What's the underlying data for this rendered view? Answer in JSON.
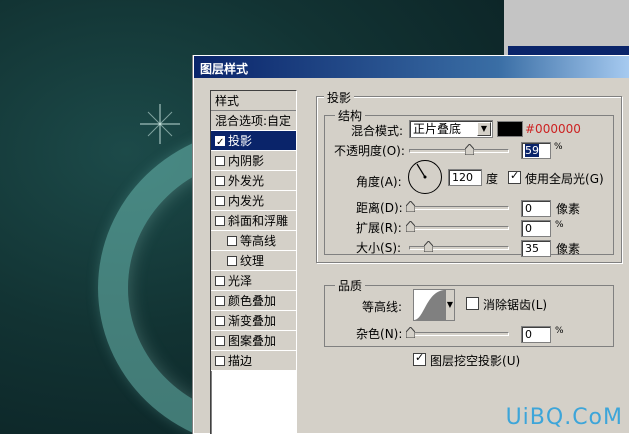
{
  "dialog": {
    "title": "图层样式"
  },
  "sidebar": {
    "header": "样式",
    "blend_options": "混合选项:自定",
    "items": [
      {
        "label": "投影",
        "checked": true,
        "active": true,
        "indent": false
      },
      {
        "label": "内阴影",
        "checked": false,
        "active": false,
        "indent": false
      },
      {
        "label": "外发光",
        "checked": false,
        "active": false,
        "indent": false
      },
      {
        "label": "内发光",
        "checked": false,
        "active": false,
        "indent": false
      },
      {
        "label": "斜面和浮雕",
        "checked": false,
        "active": false,
        "indent": false
      },
      {
        "label": "等高线",
        "checked": false,
        "active": false,
        "indent": true
      },
      {
        "label": "纹理",
        "checked": false,
        "active": false,
        "indent": true
      },
      {
        "label": "光泽",
        "checked": false,
        "active": false,
        "indent": false
      },
      {
        "label": "颜色叠加",
        "checked": false,
        "active": false,
        "indent": false
      },
      {
        "label": "渐变叠加",
        "checked": false,
        "active": false,
        "indent": false
      },
      {
        "label": "图案叠加",
        "checked": false,
        "active": false,
        "indent": false
      },
      {
        "label": "描边",
        "checked": false,
        "active": false,
        "indent": false
      }
    ]
  },
  "shadow": {
    "section_title": "投影",
    "structure_title": "结构",
    "blend_mode_label": "混合模式:",
    "blend_mode_value": "正片叠底",
    "color_hex": "#000000",
    "opacity_label": "不透明度",
    "opacity_key": "(O):",
    "opacity_value": "59",
    "opacity_fraction": 0.59,
    "percent": "%",
    "angle_label": "角度",
    "angle_key": "(A):",
    "angle_value": "120",
    "angle_unit": "度",
    "global_light_label": "使用全局光",
    "global_light_key": "(G)",
    "global_light_checked": true,
    "distance_label": "距离",
    "distance_key": "(D):",
    "distance_value": "0",
    "spread_label": "扩展",
    "spread_key": "(R):",
    "spread_value": "0",
    "size_label": "大小",
    "size_key": "(S):",
    "size_value": "35",
    "pixel_unit": "像素"
  },
  "quality": {
    "title": "品质",
    "contour_label": "等高线:",
    "antialias_label": "消除锯齿",
    "antialias_key": "(L)",
    "antialias_checked": false,
    "noise_label": "杂色",
    "noise_key": "(N):",
    "noise_value": "0",
    "knockout_label": "图层挖空投影",
    "knockout_key": "(U)",
    "knockout_checked": true
  },
  "watermark": "UiBQ.CoM",
  "colors": {
    "accent": "#0a246a",
    "dialog_bg": "#d4d0c8",
    "color_hex_text": "#cc2222",
    "watermark": "#3da5d9"
  }
}
